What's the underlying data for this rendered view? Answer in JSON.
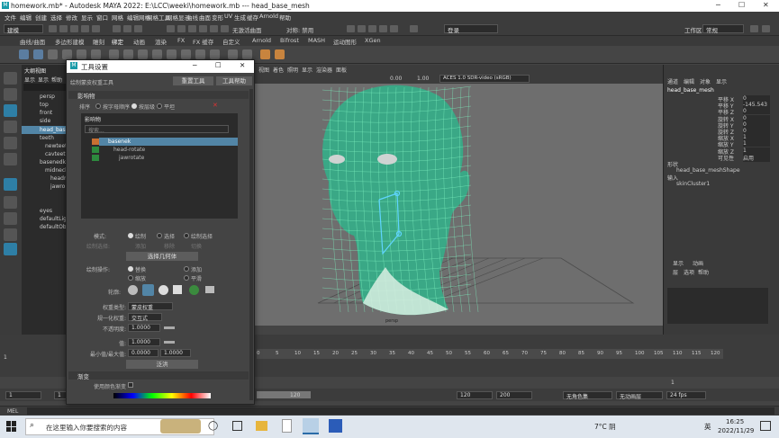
{
  "window": {
    "title": "homework.mb* - Autodesk MAYA 2022: E:\\LCC\\weeki\\homework.mb   ---   head_base_mesh"
  },
  "menubar": [
    "文件",
    "编辑",
    "创建",
    "选择",
    "修改",
    "显示",
    "窗口",
    "网格",
    "编辑网格",
    "网格工具",
    "网格显示",
    "曲线",
    "曲面",
    "变形",
    "UV",
    "生成",
    "缓存",
    "Arnold",
    "帮助"
  ],
  "status": {
    "mode": "建模",
    "no_live": "无激活曲面",
    "symmetry": "对称: 禁用",
    "login": "登录",
    "workspace_label": "工作区:",
    "workspace": "常规"
  },
  "shelf_tabs": [
    "曲线/曲面",
    "多边形建模",
    "雕刻",
    "绑定",
    "动画",
    "渲染",
    "FX",
    "FX 缓存",
    "自定义",
    "Arnold",
    "Bifrost",
    "MASH",
    "运动图形",
    "XGen"
  ],
  "outliner": {
    "title": "大纲视图",
    "menus": [
      "显示",
      "显示",
      "帮助"
    ],
    "items": [
      "persp",
      "top",
      "front",
      "side",
      "head_base",
      "teeth",
      "newteeth",
      "cavteeth",
      "basenedk",
      "midneck",
      "headro",
      "jawro",
      "eyes",
      "defaultLigh",
      "defaultObj"
    ]
  },
  "dialog": {
    "title": "工具设置",
    "tool_name": "绘制蒙皮权重工具",
    "reset_btn": "重置工具",
    "help_btn": "工具帮助",
    "sec_influence": "影响物",
    "sort_label": "排序",
    "sort_opts": [
      "按字母顺序",
      "按层级",
      "平坦"
    ],
    "influence_header": "影响物",
    "filter_placeholder": "搜索...",
    "influences": [
      "basenek",
      "head-rotate",
      "jawrotate"
    ],
    "mode_label": "模式:",
    "mode_opts": [
      "绘制",
      "选择",
      "绘制选择"
    ],
    "paint_sel_label": "绘制选择:",
    "paint_sel_opts": [
      "添加",
      "移除",
      "切换"
    ],
    "select_geo_btn": "选择几何体",
    "paint_op_label": "绘制操作:",
    "paint_ops": [
      "替换",
      "添加",
      "缩放",
      "平滑"
    ],
    "profile_label": "轮廓:",
    "weight_type_label": "权重类型:",
    "weight_type": "蒙皮权重",
    "normalize_label": "规一化权重:",
    "normalize": "交互式",
    "opacity_label": "不透明度:",
    "opacity": "1.0000",
    "value_label": "值:",
    "value": "1.0000",
    "minmax_label": "最小值/最大值:",
    "min": "0.0000",
    "max": "1.0000",
    "flood_btn": "泛洪",
    "sec_gradient": "渐变",
    "color_ramp_label": "使用颜色渐变"
  },
  "viewport": {
    "menus": [
      "视图",
      "着色",
      "照明",
      "显示",
      "渲染器",
      "面板"
    ],
    "cam_label": "persp",
    "exposure": "0.00",
    "gamma": "1.00",
    "colorspace": "ACES 1.0 SDR-video (sRGB)"
  },
  "channelbox": {
    "tabs": [
      "通道",
      "编辑",
      "对象",
      "显示"
    ],
    "object": "head_base_mesh",
    "attrs": [
      {
        "n": "平移 X",
        "v": "0"
      },
      {
        "n": "平移 Y",
        "v": "-145.543"
      },
      {
        "n": "平移 Z",
        "v": "0"
      },
      {
        "n": "旋转 X",
        "v": "0"
      },
      {
        "n": "旋转 Y",
        "v": "0"
      },
      {
        "n": "旋转 Z",
        "v": "0"
      },
      {
        "n": "缩放 X",
        "v": "1"
      },
      {
        "n": "缩放 Y",
        "v": "1"
      },
      {
        "n": "缩放 Z",
        "v": "1"
      },
      {
        "n": "可见性",
        "v": "启用"
      }
    ],
    "shapes_label": "形状",
    "shape": "head_base_meshShape",
    "inputs_label": "输入",
    "input": "skinCluster1",
    "layer_tabs": [
      "显示",
      "动画"
    ],
    "layer_menus": [
      "层",
      "选项",
      "帮助"
    ]
  },
  "timeline": {
    "ticks": [
      "0",
      "5",
      "10",
      "15",
      "20",
      "25",
      "30",
      "35",
      "40",
      "45",
      "50",
      "55",
      "60",
      "65",
      "70",
      "75",
      "80",
      "85",
      "90",
      "95",
      "100",
      "105",
      "110",
      "115",
      "120"
    ],
    "current": "1",
    "range_start": "1",
    "range_inner": "1",
    "range_end_inner": "120",
    "range_end": "120",
    "range_max": "200",
    "char_set": "无角色集",
    "anim_layer": "无动画层",
    "fps": "24 fps",
    "mel": "MEL"
  },
  "taskbar": {
    "search_placeholder": "在这里输入你要搜索的内容",
    "weather": "7°C 阴",
    "lang": "英",
    "time": "16:25",
    "date": "2022/11/29"
  }
}
